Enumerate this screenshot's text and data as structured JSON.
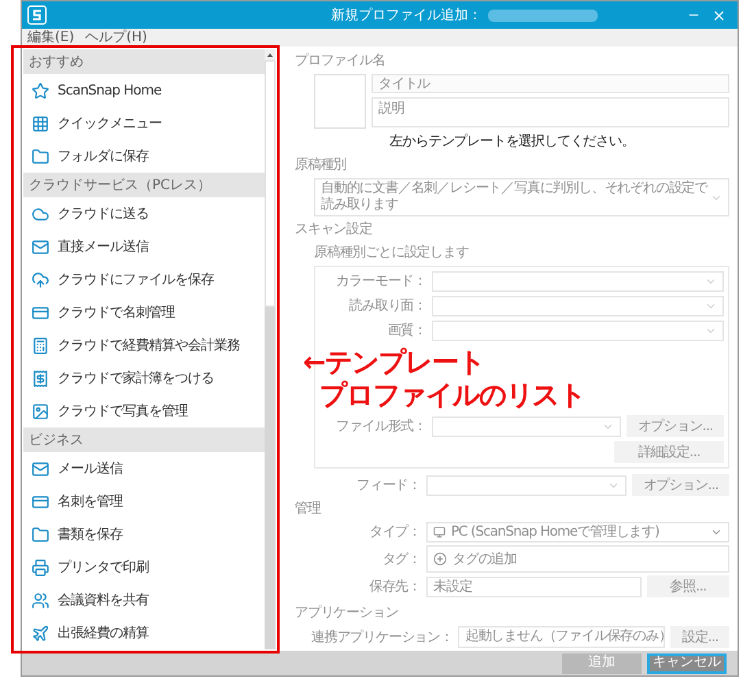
{
  "window": {
    "title": "新規プロファイル追加："
  },
  "menu": [
    "編集(E)",
    "ヘルプ(H)"
  ],
  "template_list": {
    "sections": [
      {
        "header": "おすすめ",
        "items": [
          {
            "label": "ScanSnap Home"
          },
          {
            "label": "クイックメニュー"
          },
          {
            "label": "フォルダに保存"
          }
        ]
      },
      {
        "header": "クラウドサービス（PCレス）",
        "items": [
          {
            "label": "クラウドに送る"
          },
          {
            "label": "直接メール送信"
          },
          {
            "label": "クラウドにファイルを保存"
          },
          {
            "label": "クラウドで名刺管理"
          },
          {
            "label": "クラウドで経費精算や会計業務"
          },
          {
            "label": "クラウドで家計簿をつける"
          },
          {
            "label": "クラウドで写真を管理"
          }
        ]
      },
      {
        "header": "ビジネス",
        "items": [
          {
            "label": "メール送信"
          },
          {
            "label": "名刺を管理"
          },
          {
            "label": "書類を保存"
          },
          {
            "label": "プリンタで印刷"
          },
          {
            "label": "会議資料を共有"
          },
          {
            "label": "出張経費の精算"
          }
        ]
      }
    ]
  },
  "form": {
    "disabled": true,
    "center_message": "左からテンプレートを選択してください。",
    "profile_name": {
      "label": "プロファイル名",
      "title_placeholder": "タイトル",
      "description_placeholder": "説明"
    },
    "document_type": {
      "label": "原稿種別",
      "value": "自動的に文書／名刺／レシート／写真に判別し、それぞれの設定で読み取ります"
    },
    "scan_settings": {
      "label": "スキャン設定",
      "note": "原稿種別ごとに設定します",
      "rows": [
        {
          "label": "カラーモード："
        },
        {
          "label": "読み取り面："
        },
        {
          "label": "画質："
        },
        {
          "label": "ファイル形式：",
          "button": "オプション..."
        }
      ],
      "detail_button": "詳細設定..."
    },
    "feed": {
      "label": "フィード：",
      "button": "オプション..."
    },
    "management": {
      "label": "管理",
      "type_label": "タイプ：",
      "type_value": "PC (ScanSnap Homeで管理します)",
      "tag_label": "タグ：",
      "tag_placeholder": "タグの追加",
      "save_label": "保存先：",
      "save_placeholder": "未設定",
      "browse_button": "参照..."
    },
    "application": {
      "label": "アプリケーション",
      "link_label": "連携アプリケーション：",
      "link_value": "起動しません（ファイル保存のみ）",
      "settings_button": "設定..."
    }
  },
  "annotation": {
    "lines": [
      "←テンプレート",
      "プロファイルのリスト"
    ]
  },
  "buttons": [
    {
      "label": "追加",
      "disabled": true
    },
    {
      "label": "キャンセル",
      "disabled": false
    }
  ]
}
